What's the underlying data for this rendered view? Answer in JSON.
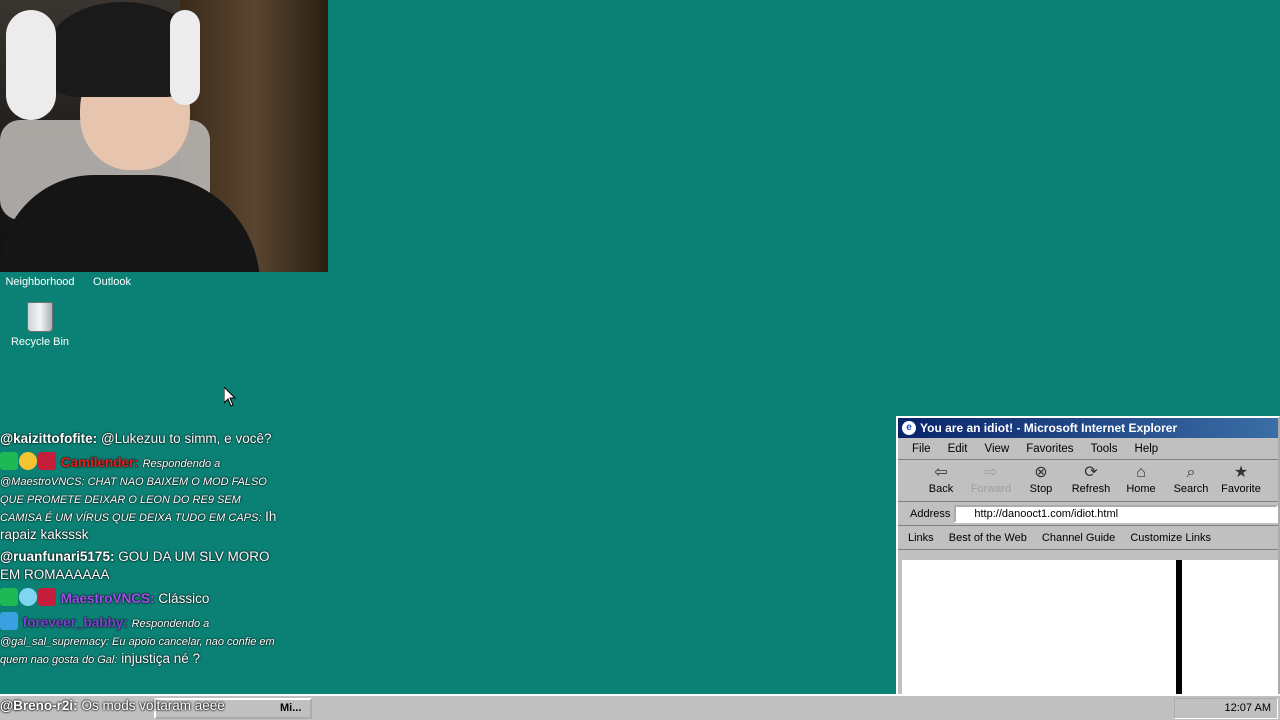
{
  "desktop": {
    "icons": [
      {
        "label": "Neighborhood"
      },
      {
        "label": "Outlook"
      },
      {
        "label": "Recycle Bin"
      }
    ]
  },
  "chat": {
    "messages": [
      {
        "user": "@kaizittofofite:",
        "text": "@Lukezuu to simm, e você?"
      },
      {
        "user": "Camilender:",
        "reply": "Respondendo a @MaestroVNCS: CHAT NAO BAIXEM O MOD FALSO QUE PROMETE DEIXAR O LEON DO RE9 SEM CAMISA É UM VÍRUS QUE DEIXA TUDO EM CAPS:",
        "text": "Ih rapaiz kaksssk"
      },
      {
        "user": "@ruanfunari5175:",
        "text": "GOU DA UM SLV MORO EM ROMAAAAAA"
      },
      {
        "user": "MaestroVNCS:",
        "text": "Clássico"
      },
      {
        "user": "foreveer_babby:",
        "reply": "Respondendo a @gal_sal_supremacy: Eu apoio cancelar, nao confie em quem nao gosta do Gal:",
        "text": "injustiça né ?"
      },
      {
        "user": "@Breno-r2i:",
        "text": "Os mods voltaram aeee"
      }
    ],
    "colors": {
      "camilender": "#e5201f",
      "maestro": "#a44df0",
      "foreveer": "#7b45d6"
    }
  },
  "ie": {
    "title": "You are an idiot! - Microsoft Internet Explorer",
    "menu": [
      "File",
      "Edit",
      "View",
      "Favorites",
      "Tools",
      "Help"
    ],
    "toolbar": [
      "Back",
      "Forward",
      "Stop",
      "Refresh",
      "Home",
      "Search",
      "Favorite"
    ],
    "address_label": "Address",
    "address_url": "http://danooct1.com/idiot.html",
    "links_label": "Links",
    "links": [
      "Best of the Web",
      "Channel Guide",
      "Customize Links"
    ]
  },
  "taskbar": {
    "task_label": "Mi...",
    "clock": "12:07 AM"
  }
}
